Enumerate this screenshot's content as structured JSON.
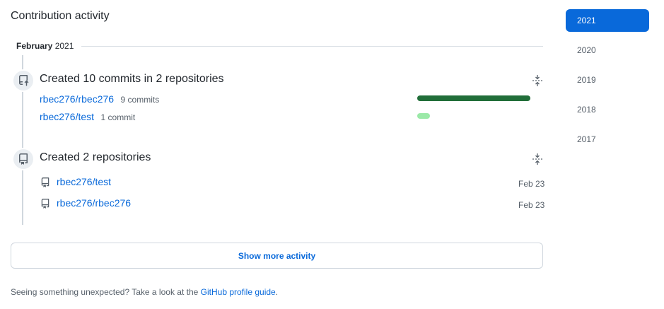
{
  "heading": "Contribution activity",
  "month": {
    "name": "February",
    "year": "2021"
  },
  "events": [
    {
      "title": "Created 10 commits in 2 repositories",
      "repos": [
        {
          "name": "rbec276/rbec276",
          "count": "9 commits",
          "share": 0.9
        },
        {
          "name": "rbec276/test",
          "count": "1 commit",
          "share": 0.1
        }
      ]
    },
    {
      "title": "Created 2 repositories",
      "repos": [
        {
          "name": "rbec276/test",
          "date": "Feb 23"
        },
        {
          "name": "rbec276/rbec276",
          "date": "Feb 23"
        }
      ]
    }
  ],
  "show_more": "Show more activity",
  "footer": {
    "text": "Seeing something unexpected? Take a look at the ",
    "link": "GitHub profile guide",
    "end": "."
  },
  "years": [
    {
      "label": "2021",
      "active": true
    },
    {
      "label": "2020",
      "active": false
    },
    {
      "label": "2019",
      "active": false
    },
    {
      "label": "2018",
      "active": false
    },
    {
      "label": "2017",
      "active": false
    }
  ],
  "colors": {
    "accent": "#0969da",
    "bar_dark": "#216e39",
    "bar_light": "#9be9a8"
  }
}
